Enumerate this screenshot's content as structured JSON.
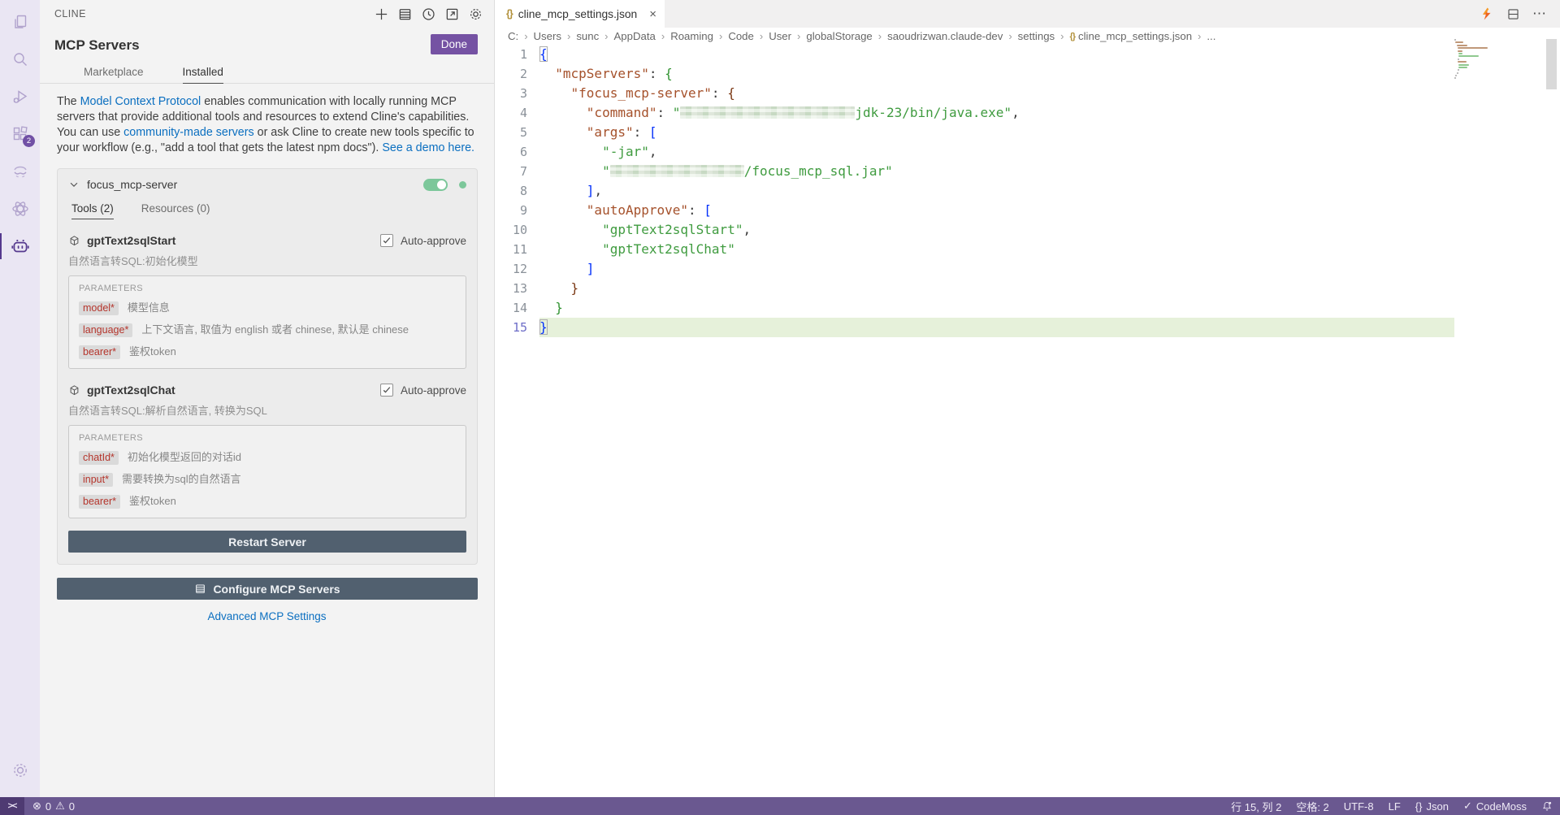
{
  "colors": {
    "accent_purple": "#7552a3",
    "status_bar": "#6a5890",
    "slate_button": "#51606f",
    "toggle_green": "#7cc79a",
    "link_blue": "#0b6fc0",
    "json_key": "#a5512b",
    "json_string": "#3f9b3f",
    "line_highlight": "#e6f1da"
  },
  "activity_bar": {
    "icons": [
      "explorer",
      "search",
      "run-debug",
      "extensions",
      "wave-extension",
      "openai-extension",
      "cline-robot",
      "settings-gear"
    ],
    "extensions_badge": "2"
  },
  "sidebar": {
    "title": "CLINE",
    "toolbar_icons": [
      "plus",
      "mcp-servers",
      "history",
      "open-in-editor",
      "settings-gear"
    ],
    "heading": "MCP Servers",
    "done_label": "Done",
    "tabs": {
      "marketplace": "Marketplace",
      "installed": "Installed"
    },
    "description": [
      "The ",
      "Model Context Protocol",
      " enables communication with locally running MCP servers that provide additional tools and resources to extend Cline's capabilities. You can use ",
      "community-made servers",
      " or ask Cline to create new tools specific to your workflow (e.g., \"add a tool that gets the latest npm docs\"). ",
      "See a demo here."
    ],
    "server": {
      "name": "focus_mcp-server",
      "enabled": true,
      "tools_tab": "Tools (2)",
      "resources_tab": "Resources (0)",
      "auto_approve_label": "Auto-approve",
      "parameters_label": "PARAMETERS",
      "tools": [
        {
          "name": "gptText2sqlStart",
          "description": "自然语言转SQL:初始化模型",
          "params": [
            {
              "name": "model*",
              "desc": "模型信息"
            },
            {
              "name": "language*",
              "desc": "上下文语言, 取值为 english 或者 chinese, 默认是 chinese"
            },
            {
              "name": "bearer*",
              "desc": "鉴权token"
            }
          ]
        },
        {
          "name": "gptText2sqlChat",
          "description": "自然语言转SQL:解析自然语言, 转换为SQL",
          "params": [
            {
              "name": "chatId*",
              "desc": "初始化模型返回的对话id"
            },
            {
              "name": "input*",
              "desc": "需要转换为sql的自然语言"
            },
            {
              "name": "bearer*",
              "desc": "鉴权token"
            }
          ]
        }
      ],
      "restart_label": "Restart Server"
    },
    "configure_label": "Configure MCP Servers",
    "advanced_label": "Advanced MCP Settings"
  },
  "editor": {
    "tab": {
      "filename": "cline_mcp_settings.json",
      "close": "×"
    },
    "breadcrumb": [
      "C:",
      "Users",
      "sunc",
      "AppData",
      "Roaming",
      "Code",
      "User",
      "globalStorage",
      "saoudrizwan.claude-dev",
      "settings",
      "cline_mcp_settings.json",
      "..."
    ],
    "code": {
      "lines": [
        {
          "t": [
            [
              "{",
              "b1 bm"
            ]
          ]
        },
        {
          "t": [
            [
              "  ",
              ""
            ],
            [
              "\"mcpServers\"",
              "key"
            ],
            [
              ": ",
              ""
            ],
            [
              "{",
              "b2"
            ]
          ]
        },
        {
          "t": [
            [
              "    ",
              ""
            ],
            [
              "\"focus_mcp-server\"",
              "key"
            ],
            [
              ": ",
              ""
            ],
            [
              "{",
              "b3"
            ]
          ]
        },
        {
          "t": [
            [
              "      ",
              ""
            ],
            [
              "\"command\"",
              "key"
            ],
            [
              ": ",
              ""
            ],
            [
              "\"",
              "str"
            ],
            [
              "",
              "redact",
              215
            ],
            [
              "jdk-23/bin/java.exe\"",
              "str"
            ],
            [
              ",",
              ""
            ]
          ]
        },
        {
          "t": [
            [
              "      ",
              ""
            ],
            [
              "\"args\"",
              "key"
            ],
            [
              ": ",
              ""
            ],
            [
              "[",
              "b1"
            ]
          ]
        },
        {
          "t": [
            [
              "        ",
              ""
            ],
            [
              "\"-jar\"",
              "str"
            ],
            [
              ",",
              ""
            ]
          ]
        },
        {
          "t": [
            [
              "        ",
              ""
            ],
            [
              "\"",
              "str"
            ],
            [
              "",
              "redact",
              165
            ],
            [
              "/focus_mcp_sql.jar\"",
              "str"
            ]
          ]
        },
        {
          "t": [
            [
              "      ",
              ""
            ],
            [
              "]",
              "b1"
            ],
            [
              ",",
              ""
            ]
          ]
        },
        {
          "t": [
            [
              "      ",
              ""
            ],
            [
              "\"autoApprove\"",
              "key"
            ],
            [
              ": ",
              ""
            ],
            [
              "[",
              "b1"
            ]
          ]
        },
        {
          "t": [
            [
              "        ",
              ""
            ],
            [
              "\"gptText2sqlStart\"",
              "str"
            ],
            [
              ",",
              ""
            ]
          ]
        },
        {
          "t": [
            [
              "        ",
              ""
            ],
            [
              "\"gptText2sqlChat\"",
              "str"
            ]
          ]
        },
        {
          "t": [
            [
              "      ",
              ""
            ],
            [
              "]",
              "b1"
            ]
          ]
        },
        {
          "t": [
            [
              "    ",
              ""
            ],
            [
              "}",
              "b3"
            ]
          ]
        },
        {
          "t": [
            [
              "  ",
              ""
            ],
            [
              "}",
              "b2"
            ]
          ]
        },
        {
          "t": [
            [
              "}",
              "b1 bm"
            ]
          ],
          "hl": true
        }
      ]
    }
  },
  "status_bar": {
    "errors": "0",
    "warnings": "0",
    "cursor": "行 15, 列 2",
    "indent": "空格: 2",
    "encoding": "UTF-8",
    "eol": "LF",
    "language": "Json",
    "extension": "CodeMoss"
  }
}
